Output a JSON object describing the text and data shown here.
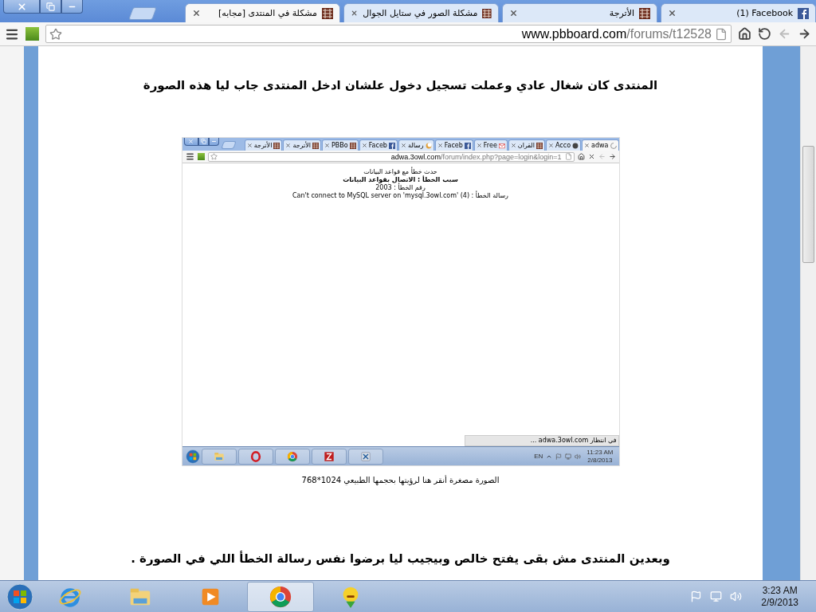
{
  "tabs": [
    {
      "title": "(1) Facebook",
      "kind": "facebook",
      "selected": false
    },
    {
      "title": "الأترجة",
      "kind": "forum",
      "selected": false
    },
    {
      "title": "مشكلة الصور في ستايل الجوال",
      "kind": "forum",
      "selected": false
    },
    {
      "title": "[مجابه] مشكلة في المنتدى",
      "kind": "forum",
      "selected": true
    }
  ],
  "address_bar": {
    "domain": "www.pbboard.com",
    "path": "/forums/t12528"
  },
  "nav_buttons": [
    {
      "kind": "home",
      "disabled": false
    },
    {
      "kind": "reload",
      "disabled": false
    },
    {
      "kind": "back",
      "disabled": true
    },
    {
      "kind": "forward",
      "disabled": false
    }
  ],
  "post": {
    "heading": "المنتدى كان شغال عادي وعملت تسجيل دخول علشان ادخل المنتدى جاب ليا هذه الصورة",
    "screenshot": {
      "tabs": [
        {
          "title": "adwa",
          "kind": "loading",
          "selected": true
        },
        {
          "title": "Acco",
          "kind": "dark",
          "selected": false
        },
        {
          "title": "القران",
          "kind": "forum",
          "selected": false
        },
        {
          "title": "Free",
          "kind": "mail",
          "selected": false
        },
        {
          "title": "Faceb",
          "kind": "facebook",
          "selected": false
        },
        {
          "title": "رسالة",
          "kind": "moon",
          "selected": false
        },
        {
          "title": "Faceb",
          "kind": "facebook",
          "selected": false
        },
        {
          "title": "PBBo",
          "kind": "forum",
          "selected": false
        },
        {
          "title": "الأترجة",
          "kind": "forum",
          "selected": false
        },
        {
          "title": "الأترجة",
          "kind": "forum",
          "selected": false
        }
      ],
      "address_bar": {
        "domain": "adwa.3owl.com",
        "path": "/forum/index.php?page=login&login=1"
      },
      "nav_buttons": [
        {
          "kind": "home",
          "disabled": false
        },
        {
          "kind": "stop",
          "disabled": false
        },
        {
          "kind": "back",
          "disabled": true
        },
        {
          "kind": "forward",
          "disabled": false
        }
      ],
      "error_lines": [
        {
          "text": "حدث خطأ مع قواعد البيانات",
          "bold": false
        },
        {
          "text": "سبب الخطأ : الاتصال بقواعد البيانات",
          "bold": true
        },
        {
          "text": "رقم الخطأ : 2003",
          "bold": false
        },
        {
          "text": "رسالة الخطأ : Can't connect to MySQL server on 'mysql.3owl.com' (4)",
          "bold": false
        }
      ],
      "status": "في انتظار adwa.3owl.com ...",
      "taskbar": {
        "apps": [
          {
            "kind": "explorer",
            "selected": false
          },
          {
            "kind": "opera",
            "selected": false
          },
          {
            "kind": "chrome",
            "selected": false
          },
          {
            "kind": "filezilla",
            "selected": false
          },
          {
            "kind": "xapp",
            "selected": false
          }
        ],
        "language": "EN",
        "time": "11:23 AM",
        "date": "2/8/2013"
      }
    },
    "caption": "الصورة مصغرة أنقر هنا لرؤيتها بحجمها الطبيعي 1024*768",
    "closing": "وبعدين المنتدى مش بقى يفتح خالص وبيجيب ليا برضوا نفس رسالة الخطأ اللي في الصورة ."
  },
  "taskbar": {
    "apps": [
      {
        "kind": "ie",
        "selected": false
      },
      {
        "kind": "explorer",
        "selected": false
      },
      {
        "kind": "media",
        "selected": false
      },
      {
        "kind": "chrome",
        "selected": true
      },
      {
        "kind": "smiley",
        "selected": false
      }
    ],
    "time": "3:23 AM",
    "date": "2/9/2013"
  }
}
